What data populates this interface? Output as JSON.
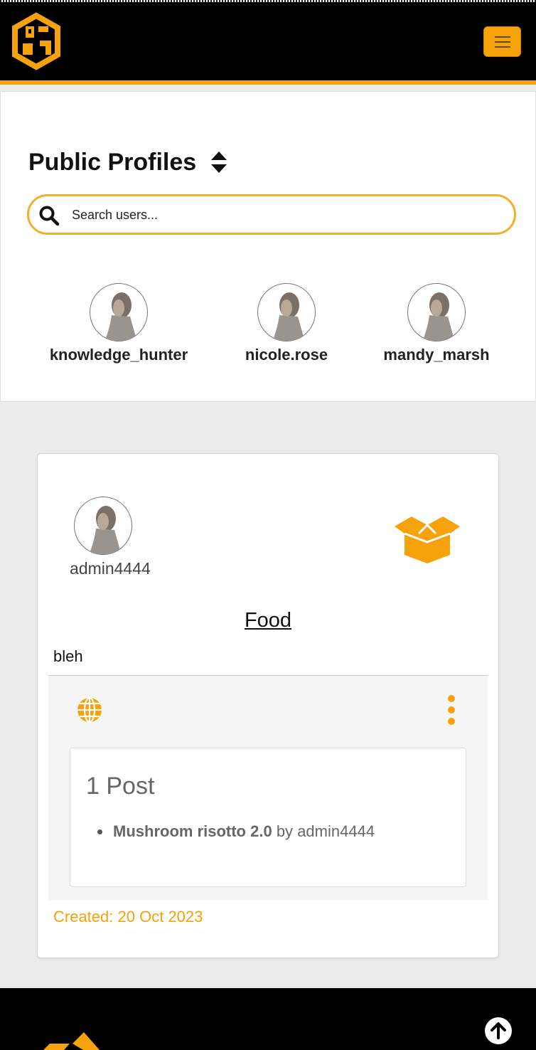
{
  "header": {
    "logo_icon": "pcg-logo-icon",
    "menu_icon": "hamburger-icon",
    "accent": "#f5a20b"
  },
  "profiles": {
    "title": "Public Profiles",
    "sort_icon": "sort-icon",
    "search": {
      "placeholder": "Search users...",
      "value": ""
    },
    "users": [
      {
        "name": "knowledge_hunter"
      },
      {
        "name": "nicole.rose"
      },
      {
        "name": "mandy_marsh"
      }
    ]
  },
  "card": {
    "author": "admin4444",
    "category_icon": "open-box-icon",
    "title": "Food",
    "description": "bleh",
    "visibility_icon": "globe-icon",
    "options_icon": "kebab-menu-icon",
    "posts_heading": "1 Post",
    "posts": [
      {
        "title": "Mushroom risotto 2.0",
        "by": "by",
        "author": "admin4444"
      }
    ],
    "created": "Created: 20 Oct 2023"
  },
  "footer": {
    "logo_icon": "footer-logo-icon",
    "scroll_top_icon": "arrow-up-circle-icon"
  }
}
